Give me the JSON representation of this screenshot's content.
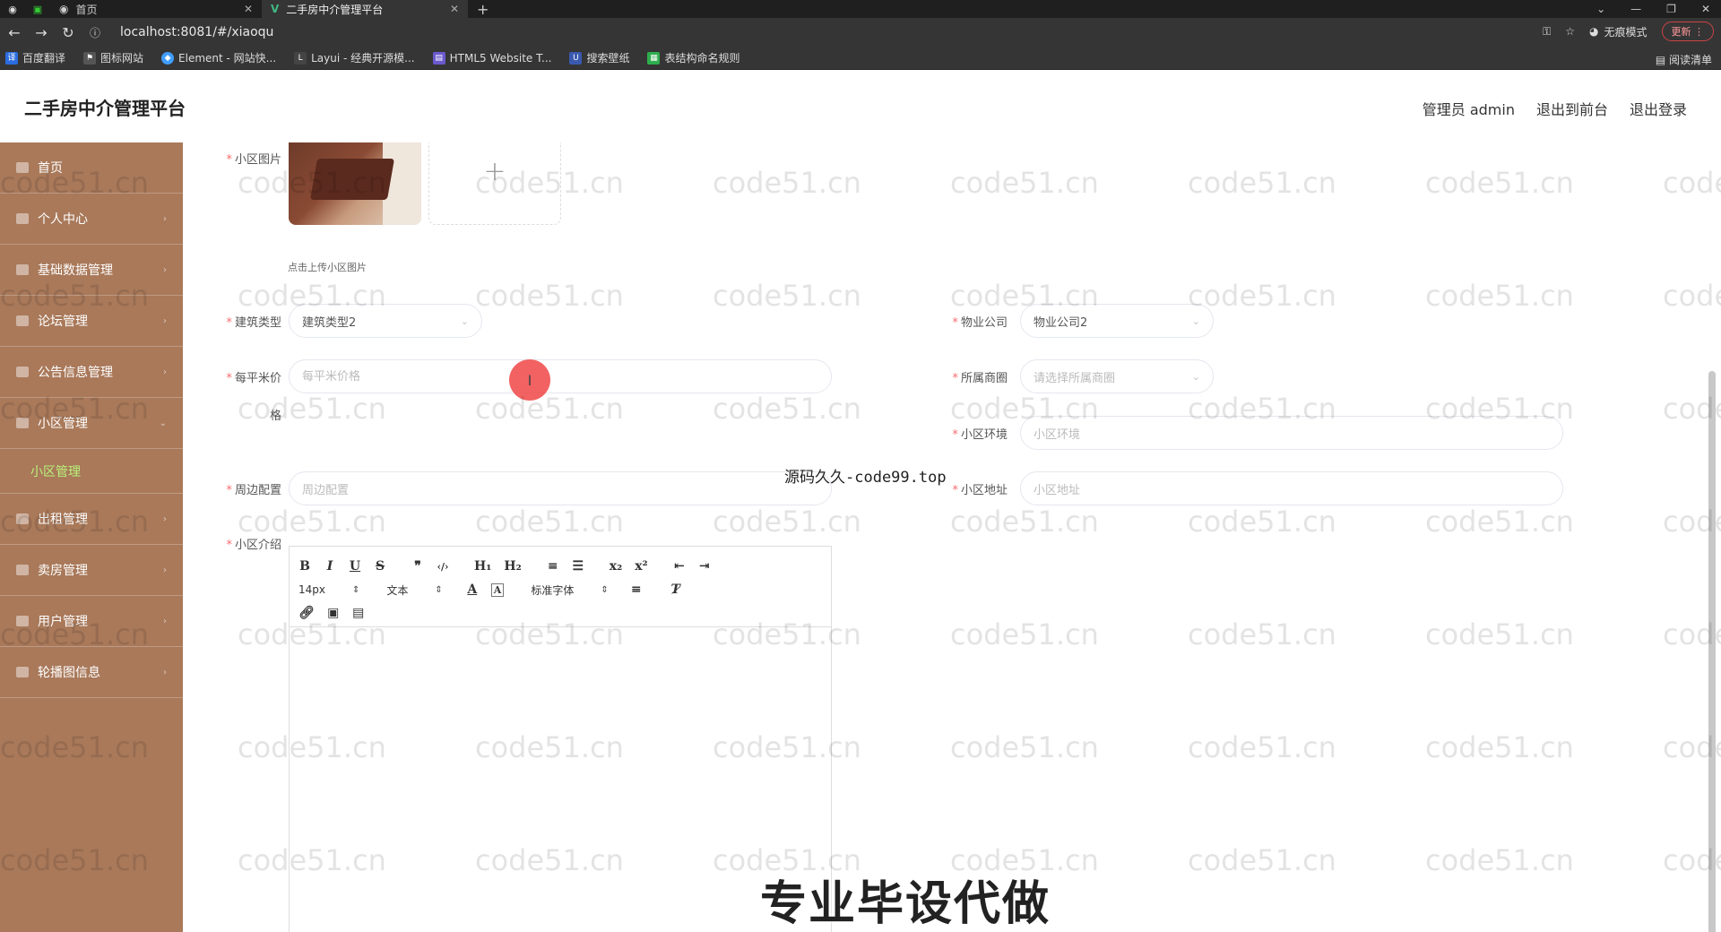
{
  "browser": {
    "tabs": [
      {
        "label": ""
      },
      {
        "label": "首页"
      },
      {
        "label": "二手房中介管理平台"
      }
    ],
    "url": "localhost:8081/#/xiaoqu",
    "incognito_label": "无痕模式",
    "update_label": "更新",
    "bookmarks": [
      "百度翻译",
      "图标网站",
      "Element - 网站快...",
      "Layui - 经典开源模...",
      "HTML5 Website T...",
      "搜索壁纸",
      "表结构命名规则"
    ],
    "reading_list": "阅读清单"
  },
  "header": {
    "title": "二手房中介管理平台",
    "admin": "管理员 admin",
    "to_front": "退出到前台",
    "logout": "退出登录"
  },
  "sidebar": {
    "items": [
      {
        "label": "首页"
      },
      {
        "label": "个人中心"
      },
      {
        "label": "基础数据管理"
      },
      {
        "label": "论坛管理"
      },
      {
        "label": "公告信息管理"
      },
      {
        "label": "小区管理"
      }
    ],
    "sub_item": "小区管理",
    "items2": [
      {
        "label": "出租管理"
      },
      {
        "label": "卖房管理"
      },
      {
        "label": "用户管理"
      },
      {
        "label": "轮播图信息"
      }
    ]
  },
  "form": {
    "image_label": "小区图片",
    "upload_tip": "点击上传小区图片",
    "building_type_label": "建筑类型",
    "building_type_value": "建筑类型2",
    "property_company_label": "物业公司",
    "property_company_value": "物业公司2",
    "price_label": "每平米价",
    "price_label_cont": "格",
    "price_placeholder": "每平米价格",
    "district_label": "所属商圈",
    "district_placeholder": "请选择所属商圈",
    "environment_label": "小区环境",
    "environment_placeholder": "小区环境",
    "surroundings_label": "周边配置",
    "surroundings_placeholder": "周边配置",
    "address_label": "小区地址",
    "address_placeholder": "小区地址",
    "intro_label": "小区介绍"
  },
  "editor": {
    "font_size": "14px",
    "format": "文本",
    "font_family": "标准字体",
    "buttons": [
      "B",
      "I",
      "U",
      "S",
      "❞",
      "‹/›",
      "H₁",
      "H₂",
      "≡",
      "☰",
      "x₂",
      "x²",
      "⇤",
      "⇥"
    ]
  },
  "overlays": {
    "watermark": "code51.cn",
    "source_text": "源码久久-code99.top",
    "banner": "专业毕设代做"
  }
}
